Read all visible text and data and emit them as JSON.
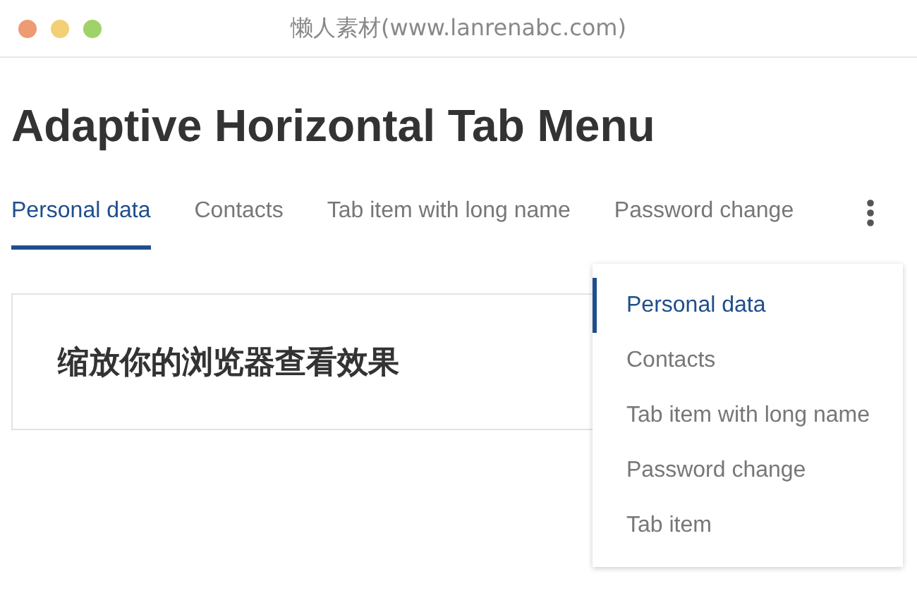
{
  "window": {
    "title": "懒人素材(www.lanrenabc.com)"
  },
  "heading": "Adaptive Horizontal Tab Menu",
  "tabs": [
    {
      "label": "Personal data",
      "selected": true
    },
    {
      "label": "Contacts",
      "selected": false
    },
    {
      "label": "Tab item with long name",
      "selected": false
    },
    {
      "label": "Password change",
      "selected": false
    }
  ],
  "more_menu": {
    "expanded": true,
    "items": [
      {
        "label": "Personal data",
        "selected": true
      },
      {
        "label": "Contacts",
        "selected": false
      },
      {
        "label": "Tab item with long name",
        "selected": false
      },
      {
        "label": "Password change",
        "selected": false
      },
      {
        "label": "Tab item",
        "selected": false
      }
    ]
  },
  "panel": {
    "text": "缩放你的浏览器查看效果"
  }
}
